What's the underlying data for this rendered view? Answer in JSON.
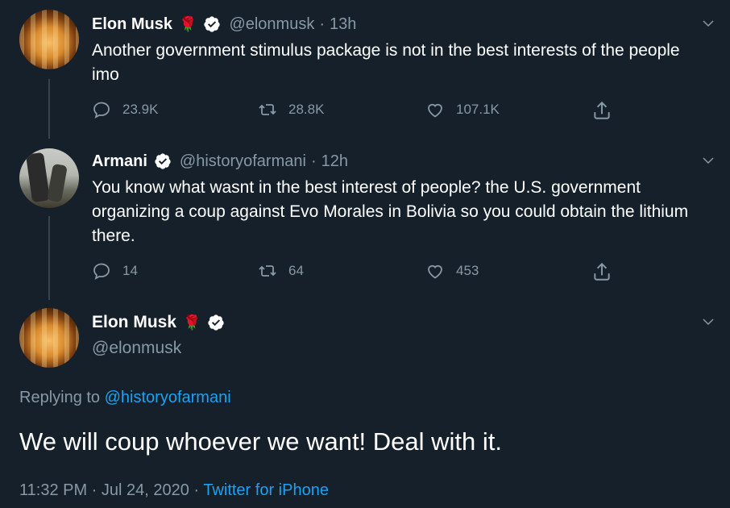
{
  "tweet1": {
    "name": "Elon Musk",
    "rose": "🌹",
    "handle": "@elonmusk",
    "sep": "·",
    "time": "13h",
    "text": "Another government stimulus package is not in the best interests of the people imo",
    "replies": "23.9K",
    "retweets": "28.8K",
    "likes": "107.1K"
  },
  "tweet2": {
    "name": "Armani",
    "handle": "@historyofarmani",
    "sep": "·",
    "time": "12h",
    "text": "You know what wasnt in the best interest of people? the U.S. government organizing a coup against Evo Morales in Bolivia so you could obtain the lithium there.",
    "replies": "14",
    "retweets": "64",
    "likes": "453"
  },
  "focus": {
    "name": "Elon Musk",
    "rose": "🌹",
    "handle": "@elonmusk",
    "replying_prefix": "Replying to ",
    "replying_handle": "@historyofarmani",
    "text": "We will coup whoever we want! Deal with it.",
    "time": "11:32 PM",
    "sep1": " · ",
    "date": "Jul 24, 2020",
    "sep2": " · ",
    "source": "Twitter for iPhone"
  },
  "colors": {
    "background": "#15202b",
    "secondary_text": "#8899a6",
    "link": "#1da1f2",
    "verified_badge": "#ffffff",
    "thread_line": "#38444d"
  },
  "icons": [
    "reply-icon",
    "retweet-icon",
    "like-icon",
    "share-icon",
    "verified-icon",
    "chevron-down-icon",
    "rose-emoji"
  ]
}
